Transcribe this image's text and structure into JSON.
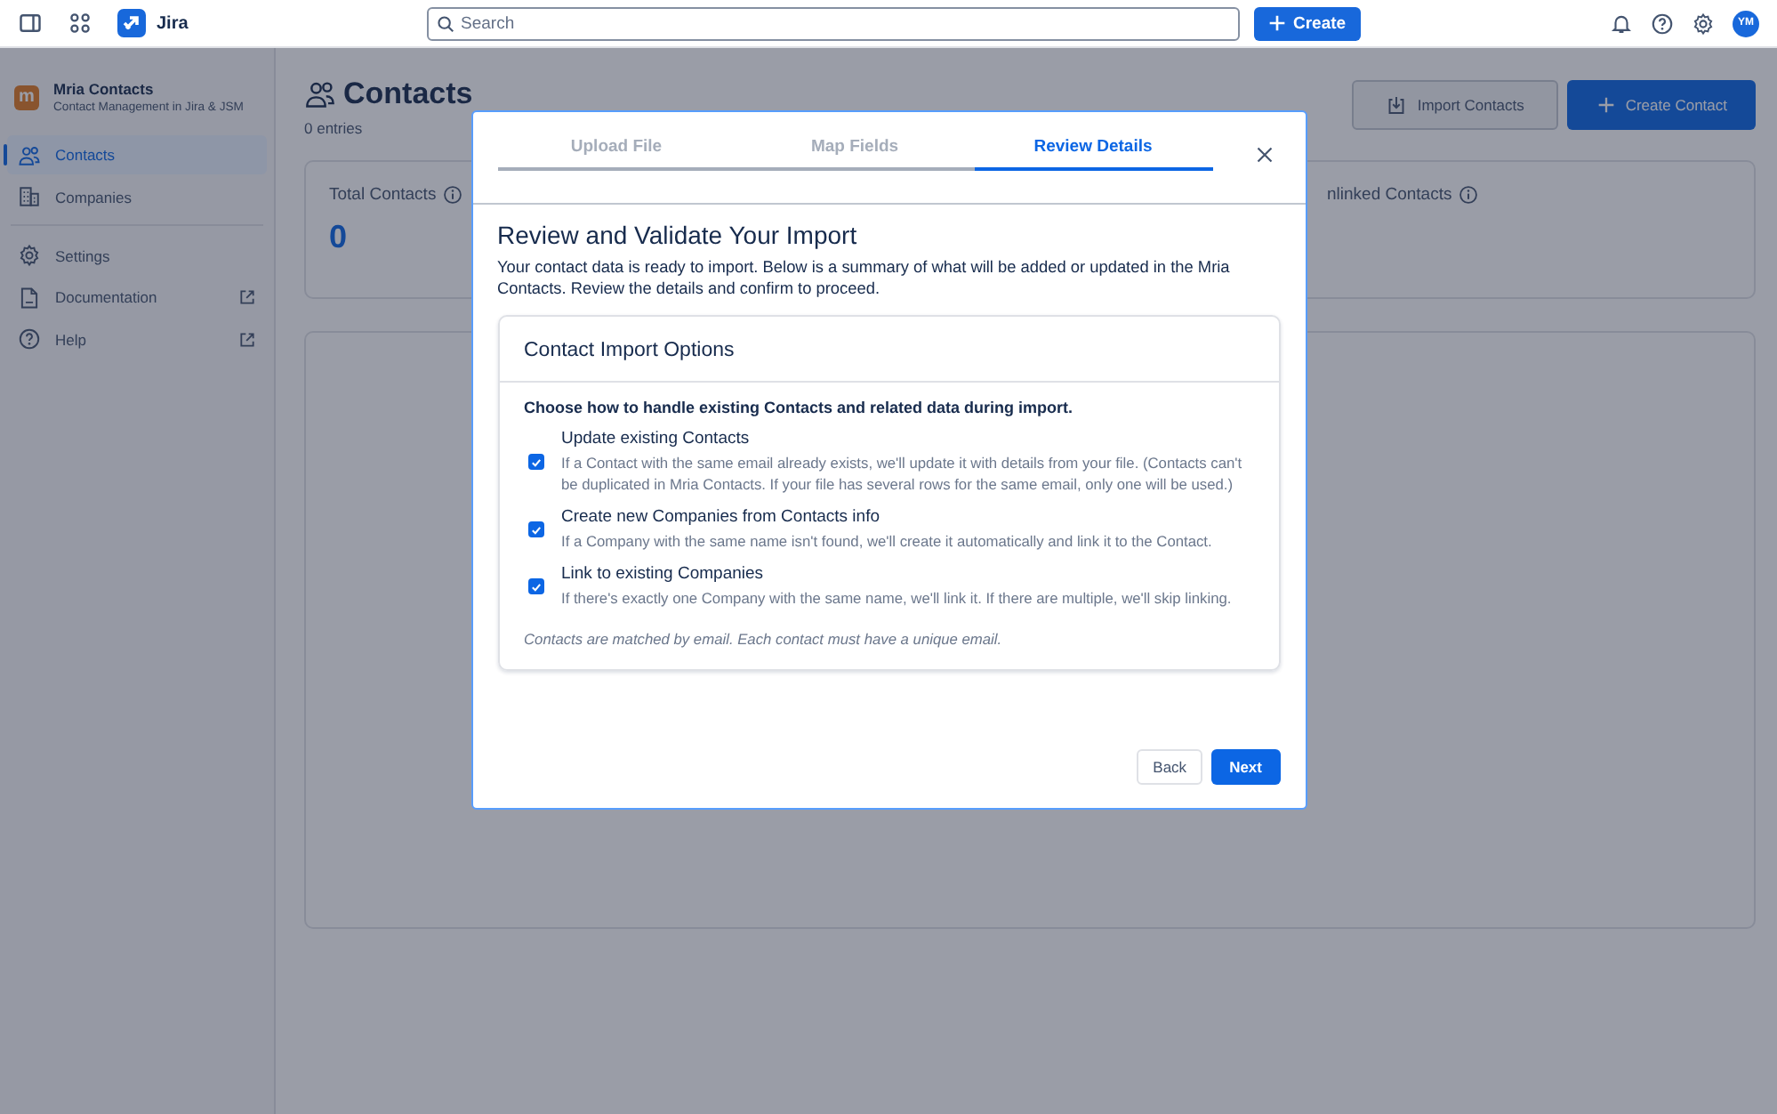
{
  "topbar": {
    "product": "Jira",
    "search": {
      "placeholder": "Search"
    },
    "create_button": "Create",
    "avatar": "YM"
  },
  "sidebar": {
    "app": {
      "logo_letter": "m",
      "name": "Mria Contacts",
      "subtitle": "Contact Management in Jira & JSM"
    },
    "items": [
      {
        "label": "Contacts",
        "selected": true,
        "external": false
      },
      {
        "label": "Companies",
        "selected": false,
        "external": false
      },
      {
        "label": "Settings",
        "selected": false,
        "external": false
      },
      {
        "label": "Documentation",
        "selected": false,
        "external": true
      },
      {
        "label": "Help",
        "selected": false,
        "external": true
      }
    ]
  },
  "page": {
    "title": "Contacts",
    "count": "0 entries",
    "buttons": [
      {
        "label": "Import Contacts",
        "kind": "secondary"
      },
      {
        "label": "Create Contact",
        "kind": "primary"
      }
    ],
    "total_card": {
      "label": "Total Contacts",
      "value": "0"
    },
    "unlinked_card": {
      "label": "nlinked Contacts"
    }
  },
  "modal": {
    "steps": [
      {
        "label": "Upload File",
        "selected": false
      },
      {
        "label": "Map Fields",
        "selected": false
      },
      {
        "label": "Review Details",
        "selected": true
      }
    ],
    "heading": "Review and Validate Your Import",
    "description": "Your contact data is ready to import. Below is a summary of what will be added or updated in the Mria Contacts. Review the details and confirm to proceed.",
    "options_card": {
      "title": "Contact Import Options",
      "instruction": "Choose how to handle existing Contacts and related data during import.",
      "options": [
        {
          "label": "Update existing Contacts",
          "help": "If a Contact with the same email already exists, we'll update it with details from your file. (Contacts can't be duplicated in Mria Contacts. If your file has several rows for the same email, only one will be used.)",
          "checked": true
        },
        {
          "label": "Create new Companies from Contacts info",
          "help": "If a Company with the same name isn't found, we'll create it automatically and link it to the Contact.",
          "checked": true
        },
        {
          "label": "Link to existing Companies",
          "help": "If there's exactly one Company with the same name, we'll link it. If there are multiple, we'll skip linking.",
          "checked": true
        }
      ],
      "note": "Contacts are matched by email. Each contact must have a unique email."
    },
    "buttons": [
      {
        "label": "Back",
        "kind": "secondary"
      },
      {
        "label": "Next",
        "kind": "primary"
      }
    ]
  }
}
